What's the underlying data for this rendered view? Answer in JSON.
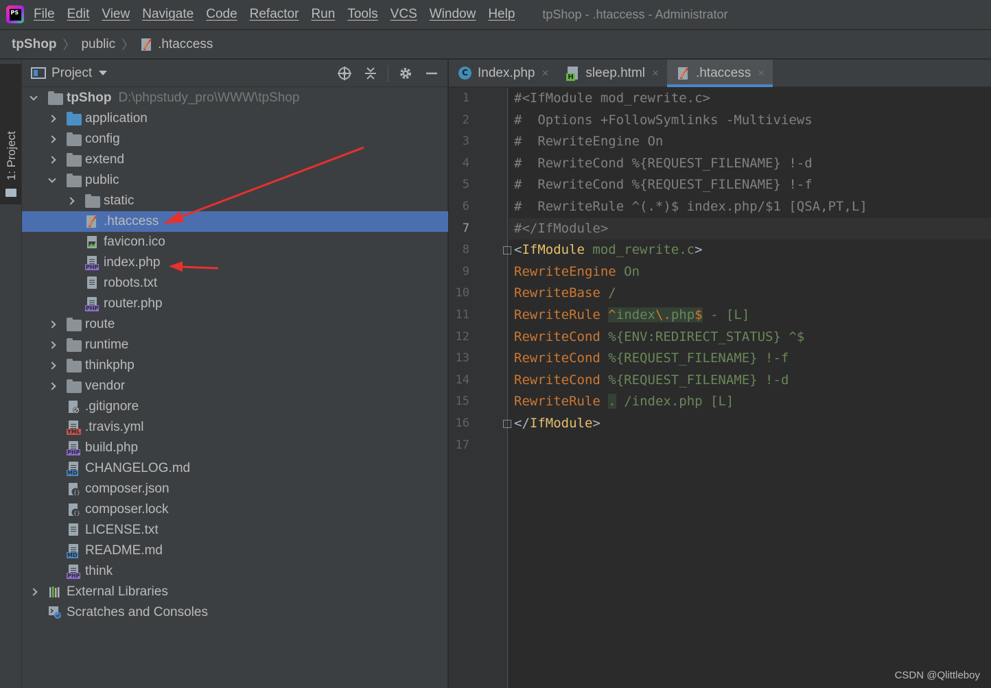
{
  "app": {
    "logo_text": "PS",
    "window_title": "tpShop - .htaccess - Administrator"
  },
  "menu": [
    "File",
    "Edit",
    "View",
    "Navigate",
    "Code",
    "Refactor",
    "Run",
    "Tools",
    "VCS",
    "Window",
    "Help"
  ],
  "breadcrumb": [
    "tpShop",
    "public",
    ".htaccess"
  ],
  "tool_stripe": {
    "project_tab": "1: Project"
  },
  "project_panel": {
    "title": "Project",
    "root": {
      "name": "tpShop",
      "path": "D:\\phpstudy_pro\\WWW\\tpShop"
    },
    "items": [
      {
        "label": "application",
        "type": "folder-blue"
      },
      {
        "label": "config",
        "type": "folder"
      },
      {
        "label": "extend",
        "type": "folder"
      },
      {
        "label": "public",
        "type": "folder"
      },
      {
        "label": "static",
        "type": "folder"
      },
      {
        "label": ".htaccess",
        "type": "htaccess"
      },
      {
        "label": "favicon.ico",
        "type": "image"
      },
      {
        "label": "index.php",
        "type": "php"
      },
      {
        "label": "robots.txt",
        "type": "txt"
      },
      {
        "label": "router.php",
        "type": "php"
      },
      {
        "label": "route",
        "type": "folder"
      },
      {
        "label": "runtime",
        "type": "folder"
      },
      {
        "label": "thinkphp",
        "type": "folder"
      },
      {
        "label": "vendor",
        "type": "folder"
      },
      {
        "label": ".gitignore",
        "type": "gitignore"
      },
      {
        "label": ".travis.yml",
        "type": "yml"
      },
      {
        "label": "build.php",
        "type": "php"
      },
      {
        "label": "CHANGELOG.md",
        "type": "md"
      },
      {
        "label": "composer.json",
        "type": "json"
      },
      {
        "label": "composer.lock",
        "type": "json"
      },
      {
        "label": "LICENSE.txt",
        "type": "txt"
      },
      {
        "label": "README.md",
        "type": "md"
      },
      {
        "label": "think",
        "type": "php"
      },
      {
        "label": "External Libraries",
        "type": "libraries"
      },
      {
        "label": "Scratches and Consoles",
        "type": "scratches"
      }
    ],
    "selected": ".htaccess"
  },
  "editor": {
    "tabs": [
      {
        "label": "Index.php",
        "close": "×"
      },
      {
        "label": "sleep.html",
        "close": "×"
      },
      {
        "label": ".htaccess",
        "close": "×"
      }
    ],
    "active_tab": ".htaccess",
    "current_line": 7,
    "line_numbers": [
      "1",
      "2",
      "3",
      "4",
      "5",
      "6",
      "7",
      "8",
      "9",
      "10",
      "11",
      "12",
      "13",
      "14",
      "15",
      "16",
      "17"
    ],
    "lines": [
      "#<IfModule mod_rewrite.c>",
      "#  Options +FollowSymlinks -Multiviews",
      "#  RewriteEngine On",
      "#  RewriteCond %{REQUEST_FILENAME} !-d",
      "#  RewriteCond %{REQUEST_FILENAME} !-f",
      "#  RewriteRule ^(.*)$ index.php/$1 [QSA,PT,L]",
      "#</IfModule>",
      "",
      "",
      "",
      "",
      "",
      "",
      "",
      "",
      "",
      ""
    ],
    "code": {
      "l8": {
        "open": "<",
        "tag": "IfModule",
        "arg": " mod_rewrite.c",
        "close": ">"
      },
      "l9": {
        "kw": "RewriteEngine",
        "arg": " On"
      },
      "l10": {
        "kw": "RewriteBase",
        "arg": " /"
      },
      "l11": {
        "kw": "RewriteRule",
        "rx_a": "^",
        "rx_b": "index",
        "rx_c": "\\.",
        "rx_d": "php",
        "rx_e": "$",
        "arg": " - [L]"
      },
      "l12": {
        "kw": "RewriteCond",
        "arg": " %{ENV:REDIRECT_STATUS} ^$"
      },
      "l13": {
        "kw": "RewriteCond",
        "arg": " %{REQUEST_FILENAME} !-f"
      },
      "l14": {
        "kw": "RewriteCond",
        "arg": " %{REQUEST_FILENAME} !-d"
      },
      "l15": {
        "kw": "RewriteRule",
        "rx": ".",
        "arg": " /index.php [L]"
      },
      "l16": {
        "open": "</",
        "tag": "IfModule",
        "close": ">"
      }
    }
  },
  "watermark": "CSDN @Qlittleboy",
  "colors": {
    "selection": "#4b6eaf",
    "annotation_arrow": "#e8302e",
    "accent": "#4a88c7"
  }
}
